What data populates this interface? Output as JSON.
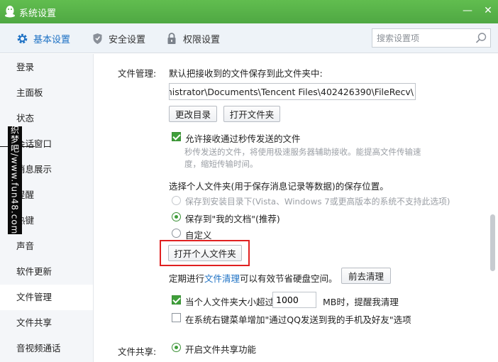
{
  "window": {
    "title": "系统设置",
    "minimize_glyph": "—",
    "close_glyph": "✕",
    "accent_color": "#55b248"
  },
  "tabs": [
    {
      "label": "基本设置",
      "icon": "gear-icon",
      "active": true
    },
    {
      "label": "安全设置",
      "icon": "shield-icon",
      "active": false
    },
    {
      "label": "权限设置",
      "icon": "lock-icon",
      "active": false
    }
  ],
  "search": {
    "placeholder": "搜索设置项",
    "value": ""
  },
  "sidebar": {
    "items": [
      {
        "label": "登录"
      },
      {
        "label": "主面板"
      },
      {
        "label": "状态"
      },
      {
        "label": "会话窗口"
      },
      {
        "label": "消息展示"
      },
      {
        "label": "提醒"
      },
      {
        "label": "热键"
      },
      {
        "label": "声音"
      },
      {
        "label": "软件更新"
      },
      {
        "label": "文件管理",
        "active": true
      },
      {
        "label": "文件共享"
      },
      {
        "label": "音视频通话"
      }
    ]
  },
  "watermark": {
    "text": "织梦吧/www.fun48.com"
  },
  "file_management": {
    "section_label": "文件管理:",
    "save_desc": "默认把接收到的文件保存到此文件夹中:",
    "path": "dministrator\\Documents\\Tencent Files\\402426390\\FileRecv\\",
    "change_dir_button": "更改目录",
    "open_folder_button": "打开文件夹",
    "allow_flash_label": "允许接收通过秒传发送的文件",
    "allow_flash_checked": true,
    "flash_desc_line1": "秒传发送的文件，将使用极速服务器辅助接收。能提高文件传输速",
    "flash_desc_line2": "度，缩短传输时间。",
    "personal_folder_desc": "选择个人文件夹(用于保存消息记录等数据)的保存位置。",
    "radio_options": [
      {
        "label": "保存到安装目录下(Vista、Windows 7或更高版本的系统不支持此选项)",
        "disabled": true,
        "checked": false
      },
      {
        "label": "保存到\"我的文档\"(推荐)",
        "disabled": false,
        "checked": true
      },
      {
        "label": "自定义",
        "disabled": false,
        "checked": false
      }
    ],
    "open_personal_folder_button": "打开个人文件夹",
    "cleanup_prefix": "定期进行",
    "cleanup_link": "文件清理",
    "cleanup_suffix": "可以有效节省硬盘空间。",
    "go_cleanup_button": "前去清理",
    "size_limit_label": "当个人文件夹大小超过",
    "size_limit_checked": true,
    "size_limit_value": "1000",
    "size_limit_suffix": "MB时，提醒我清理",
    "context_menu_label": "在系统右键菜单增加\"通过QQ发送到我的手机及好友\"选项",
    "context_menu_checked": false
  },
  "file_sharing": {
    "section_label": "文件共享:",
    "enable_label": "开启文件共享功能",
    "enable_checked": true
  }
}
